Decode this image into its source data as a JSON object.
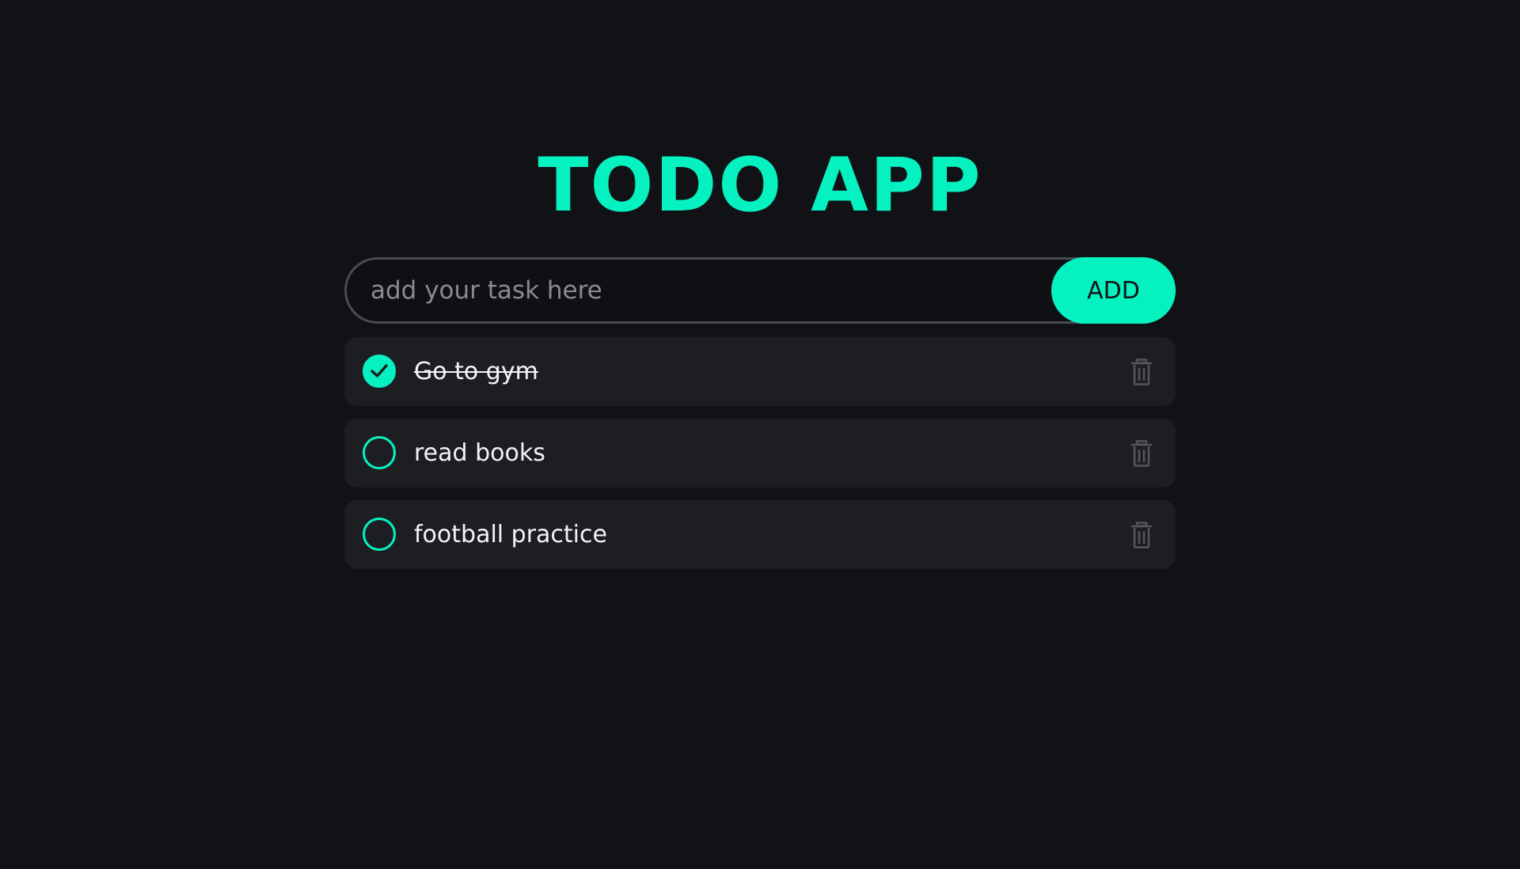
{
  "app": {
    "title": "TODO APP"
  },
  "input": {
    "placeholder": "add your task here",
    "value": "",
    "add_label": "ADD"
  },
  "tasks": [
    {
      "text": "Go to gym",
      "done": true
    },
    {
      "text": "read books",
      "done": false
    },
    {
      "text": "football practice",
      "done": false
    }
  ],
  "colors": {
    "background": "#111216",
    "accent": "#05f2c0",
    "card": "#1d1e22",
    "text": "#f4f4f6",
    "muted": "#4a4b52"
  },
  "icons": {
    "check": "check-icon",
    "delete": "trash-icon"
  }
}
